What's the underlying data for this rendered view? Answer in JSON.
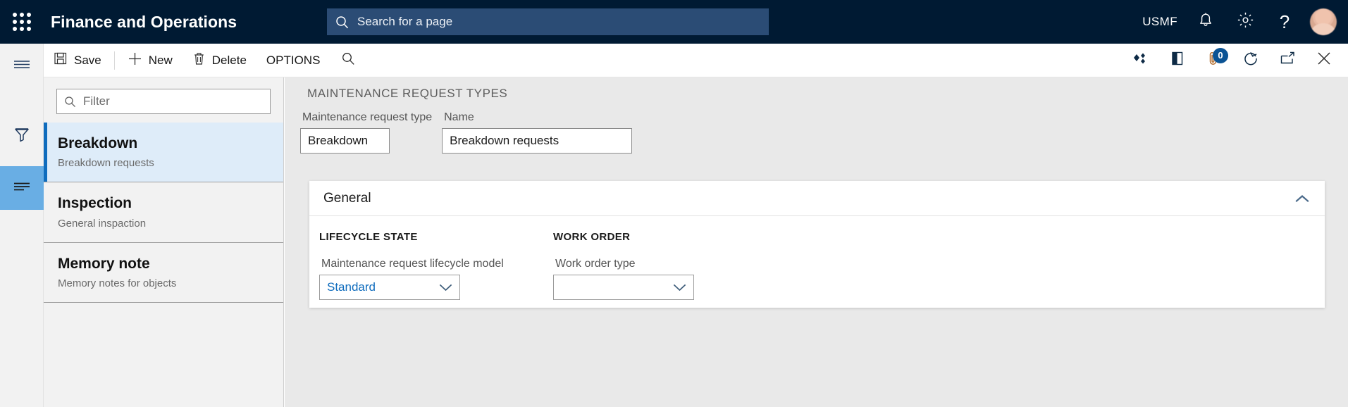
{
  "topbar": {
    "waffle_label": "App launcher",
    "app_title": "Finance and Operations",
    "search_placeholder": "Search for a page",
    "company": "USMF",
    "notifications_label": "Notifications",
    "settings_label": "Settings",
    "help_label": "?",
    "avatar_label": "User account"
  },
  "toolbar": {
    "save_label": "Save",
    "new_label": "New",
    "delete_label": "Delete",
    "options_label": "OPTIONS",
    "search_label": "Search",
    "icons": {
      "related_label": "Related information",
      "office_label": "Open in Microsoft Office",
      "attachments_label": "Attachments",
      "attachments_count": "0",
      "refresh_label": "Refresh",
      "popout_label": "Open in new window",
      "close_label": "Close"
    }
  },
  "rail": {
    "menu_label": "Show navigation",
    "filter_label": "Filter pane",
    "list_label": "Show list"
  },
  "list_panel": {
    "filter_placeholder": "Filter",
    "items": [
      {
        "title": "Breakdown",
        "subtitle": "Breakdown requests",
        "selected": true
      },
      {
        "title": "Inspection",
        "subtitle": "General inspaction",
        "selected": false
      },
      {
        "title": "Memory note",
        "subtitle": "Memory notes for objects",
        "selected": false
      }
    ]
  },
  "main": {
    "page_caption": "MAINTENANCE REQUEST TYPES",
    "header_fields": [
      {
        "label": "Maintenance request type",
        "value": "Breakdown"
      },
      {
        "label": "Name",
        "value": "Breakdown requests"
      }
    ],
    "card": {
      "title": "General",
      "collapse_icon": "chevron-up-icon",
      "groups": [
        {
          "title": "LIFECYCLE STATE",
          "field_label": "Maintenance request lifecycle model",
          "field_value": "Standard"
        },
        {
          "title": "WORK ORDER",
          "field_label": "Work order type",
          "field_value": ""
        }
      ]
    }
  },
  "colors": {
    "topbar_bg": "#001A33",
    "search_bg": "#2B4C75",
    "accent_blue": "#0F6CBD",
    "selected_row": "#DEECF9",
    "rail_active": "#69AEE4",
    "content_bg": "#E9E9E9"
  }
}
